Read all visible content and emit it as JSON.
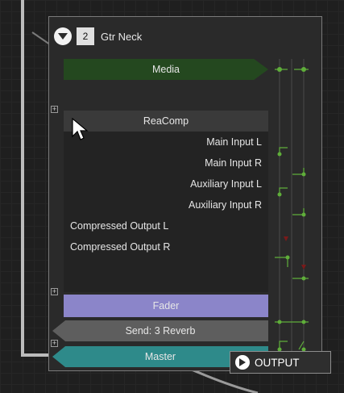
{
  "track": {
    "number": "2",
    "name": "Gtr Neck"
  },
  "media": {
    "label": "Media"
  },
  "plugin": {
    "name": "ReaComp",
    "inputs": [
      "Main Input L",
      "Main Input R",
      "Auxiliary Input L",
      "Auxiliary Input R"
    ],
    "outputs": [
      "Compressed Output L",
      "Compressed Output R"
    ]
  },
  "fader": {
    "label": "Fader"
  },
  "send": {
    "label": "Send: 3 Reverb"
  },
  "master": {
    "label": "Master"
  },
  "output_button": {
    "label": "OUTPUT"
  },
  "colors": {
    "media": "#24481f",
    "fader": "#8b85c9",
    "send": "#5e5e5e",
    "master": "#2e8a8a",
    "connector": "#5fae3a"
  },
  "icons": [
    "collapse-icon",
    "output-icon",
    "expand-plus-icon",
    "mouse-cursor-icon"
  ]
}
